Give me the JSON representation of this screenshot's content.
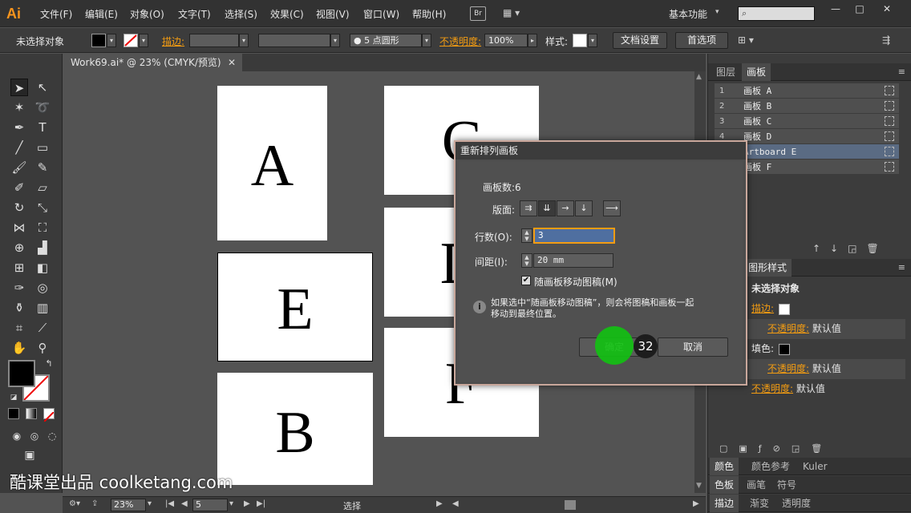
{
  "app": {
    "logo": "Ai",
    "menus": [
      "文件(F)",
      "编辑(E)",
      "对象(O)",
      "文字(T)",
      "选择(S)",
      "效果(C)",
      "视图(V)",
      "窗口(W)",
      "帮助(H)"
    ],
    "bridge": "Br",
    "workspace": "基本功能",
    "window_controls": [
      "—",
      "□",
      "✕"
    ]
  },
  "control_bar": {
    "selection_label": "未选择对象",
    "stroke_label": "描边:",
    "brush_value": "5 点圆形",
    "opacity_label": "不透明度:",
    "opacity_value": "100%",
    "style_label": "样式:",
    "doc_settings": "文档设置",
    "preferences": "首选项"
  },
  "document": {
    "tab_title": "Work69.ai* @ 23% (CMYK/预览)",
    "artboards": [
      {
        "letter": "A"
      },
      {
        "letter": "C"
      },
      {
        "letter": "E"
      },
      {
        "letter": "D"
      },
      {
        "letter": "B"
      },
      {
        "letter": "F"
      }
    ]
  },
  "status_bar": {
    "zoom": "23%",
    "page": "5",
    "mode": "选择"
  },
  "panels": {
    "top_tabs": [
      "图层",
      "画板"
    ],
    "artboard_list": [
      {
        "num": "1",
        "name": "画板 A"
      },
      {
        "num": "2",
        "name": "画板 B"
      },
      {
        "num": "3",
        "name": "画板 C"
      },
      {
        "num": "4",
        "name": "画板 D"
      },
      {
        "num": "5",
        "name": "Artboard E"
      },
      {
        "num": "6",
        "name": "画板 F"
      }
    ],
    "appearance_tab": "图形样式",
    "appearance": {
      "title": "未选择对象",
      "stroke": "描边:",
      "opacity1_label": "不透明度:",
      "opacity1_value": "默认值",
      "fill": "填色:",
      "opacity2_label": "不透明度:",
      "opacity2_value": "默认值",
      "opacity3_label": "不透明度:",
      "opacity3_value": "默认值"
    },
    "color_tabs": [
      "颜色",
      "颜色参考",
      "Kuler"
    ],
    "swatch_tabs": [
      "色板",
      "画笔",
      "符号"
    ],
    "path_tabs": [
      "描边",
      "渐变",
      "透明度"
    ]
  },
  "dialog": {
    "title": "重新排列画板",
    "count_label": "画板数:6",
    "layout_label": "版面:",
    "rows_label": "行数(O):",
    "rows_value": "3",
    "spacing_label": "间距(I):",
    "spacing_value": "20 mm",
    "move_art_label": "随画板移动图稿(M)",
    "info_text_1": "如果选中“随画板移动图稿”，则会将图稿和画板一起",
    "info_text_2": "移动到最终位置。",
    "ok": "确定",
    "cancel": "取消"
  },
  "overlay": {
    "click_count": "32",
    "watermark": "酷课堂出品 coolketang.com"
  },
  "colors": {
    "accent_orange": "#f39c12",
    "selection_blue": "#5a6b83",
    "click_green": "#12c012"
  }
}
